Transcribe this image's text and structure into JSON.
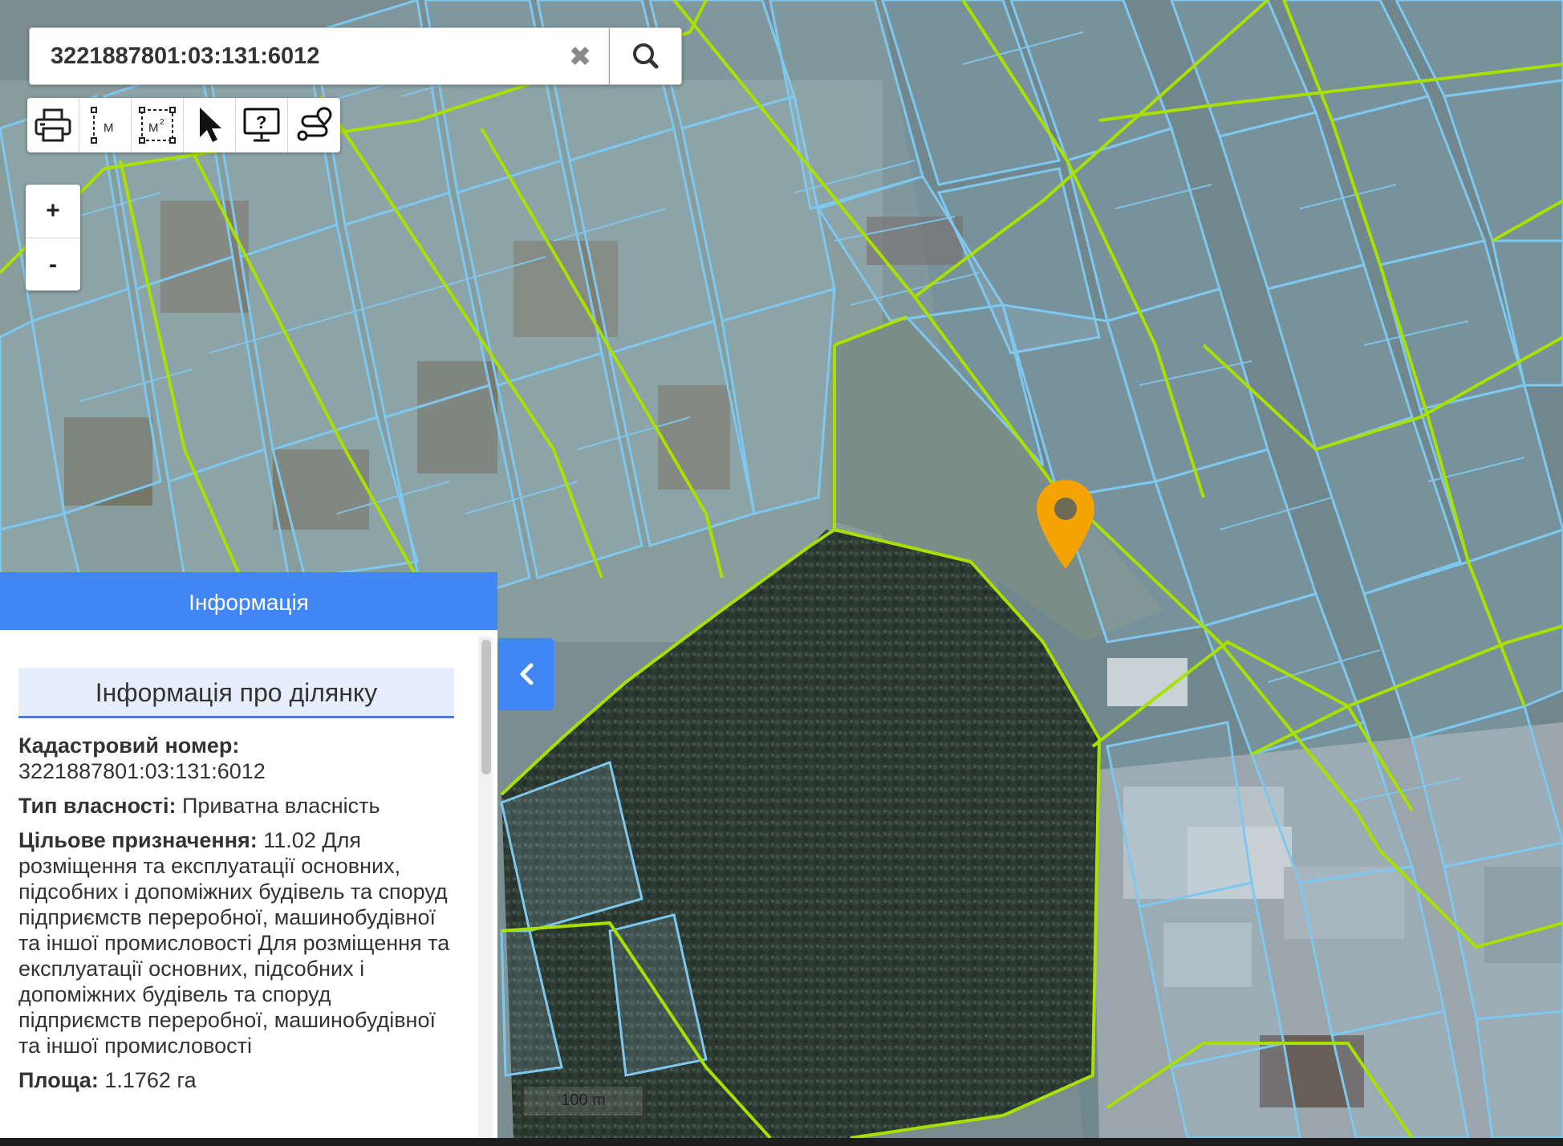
{
  "search": {
    "value": "3221887801:03:131:6012",
    "clear_icon": "close-icon",
    "search_icon": "magnifier-icon"
  },
  "toolbar": {
    "tools": [
      {
        "name": "print",
        "icon": "printer-icon"
      },
      {
        "name": "measure-distance",
        "icon": "ruler-icon",
        "label": "M"
      },
      {
        "name": "measure-area",
        "icon": "area-icon",
        "label": "M",
        "sup": "2"
      },
      {
        "name": "select",
        "icon": "pointer-icon"
      },
      {
        "name": "info",
        "icon": "monitor-question-icon",
        "label": "?"
      },
      {
        "name": "route",
        "icon": "route-icon"
      }
    ]
  },
  "zoom": {
    "in_label": "+",
    "out_label": "-"
  },
  "info_panel": {
    "header": "Інформація",
    "section_title": "Інформація про ділянку",
    "cadastral_label": "Кадастровий номер:",
    "cadastral_value": "3221887801:03:131:6012",
    "ownership_label": "Тип власності:",
    "ownership_value": " Приватна власність",
    "purpose_label": "Цільове призначення:",
    "purpose_value": " 11.02 Для розміщення та експлуатації основних, підсобних і допоміжних будівель та споруд підприємств переробної, машинобудівної та іншої промисловості Для розміщення та експлуатації основних, підсобних і допоміжних будівель та споруд підприємств переробної, машинобудівної та іншої промисловості",
    "area_label": "Площа:",
    "area_value": " 1.1762 га",
    "collapse_icon": "chevron-left-icon"
  },
  "scale": {
    "label": "100 m"
  },
  "map": {
    "marker_icon": "map-pin-icon",
    "marker_color": "#f5a300",
    "parcel_color": "#7ec8f0",
    "road_color": "#a8e000"
  }
}
